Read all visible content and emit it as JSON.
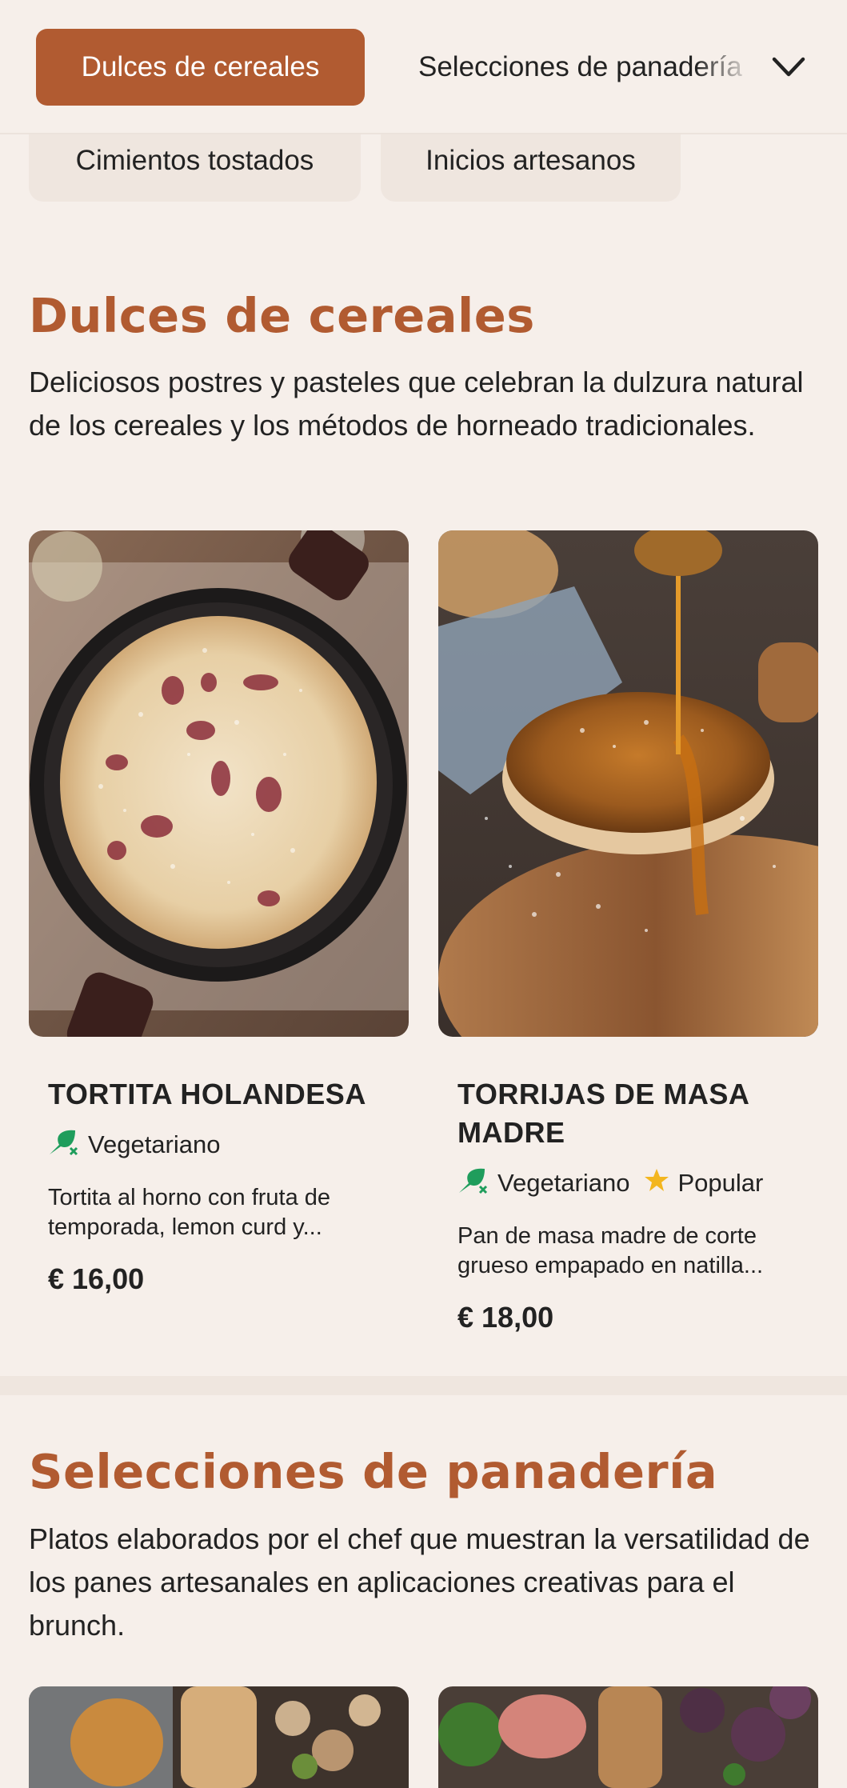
{
  "nav": {
    "active_tab": "Dulces de cereales",
    "next_tab": "Selecciones de panadería",
    "chips": [
      "Cimientos tostados",
      "Inicios artesanos"
    ]
  },
  "sections": [
    {
      "title": "Dulces de cereales",
      "description": "Deliciosos postres y pasteles que celebran la dulzura natural de los cereales y los métodos de horneado tradicionales.",
      "items": [
        {
          "name": "TORTITA HOLANDESA",
          "tags": [
            "Vegetariano"
          ],
          "description_line1": "Tortita al horno con fruta de",
          "description_line2": "temporada, lemon curd y...",
          "price": "€ 16,00"
        },
        {
          "name_line1": "TORRIJAS DE MASA",
          "name_line2": "MADRE",
          "tags": [
            "Vegetariano",
            "Popular"
          ],
          "description_line1": "Pan de masa madre de corte",
          "description_line2": "grueso empapado en natilla...",
          "price": "€ 18,00"
        }
      ]
    },
    {
      "title": "Selecciones de panadería",
      "description": "Platos elaborados por el chef que muestran la versatilidad de los panes artesanales en aplicaciones creativas para el brunch."
    }
  ],
  "icons": {
    "vegetarian": "leaf-icon",
    "popular": "star-icon",
    "chevron": "chevron-down-icon"
  },
  "colors": {
    "accent": "#b15b31",
    "background": "#f6efea",
    "vegetarian": "#1f9d5c",
    "popular": "#f3b61f"
  }
}
